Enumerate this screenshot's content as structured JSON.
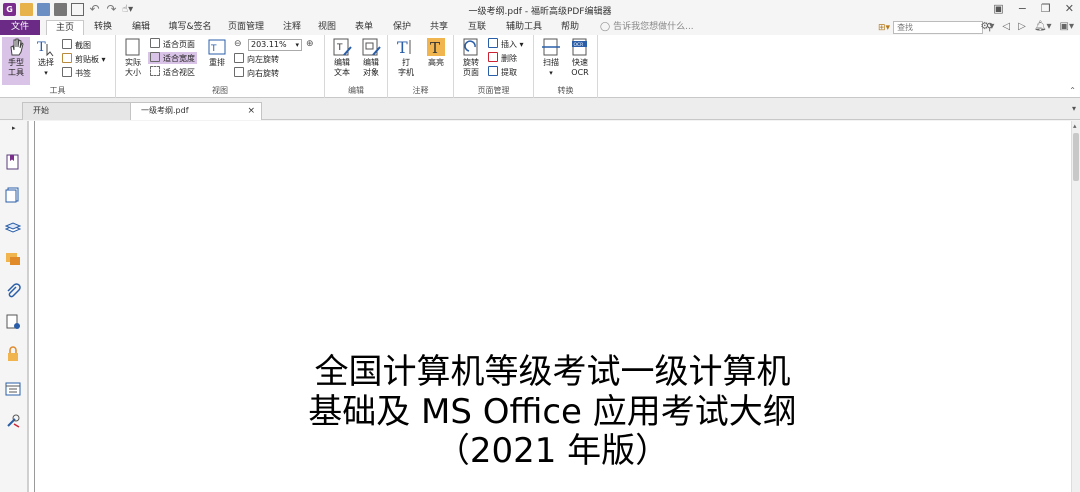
{
  "window": {
    "title": "一级考纲.pdf - 福昕高级PDF编辑器"
  },
  "quick_access": {
    "icons": [
      "app-logo-icon",
      "open-icon",
      "save-icon",
      "print-icon",
      "email-icon",
      "new-icon",
      "undo-icon",
      "redo-icon",
      "hand-icon"
    ]
  },
  "menu": {
    "file": "文件",
    "tabs": [
      "主页",
      "转换",
      "编辑",
      "填写&签名",
      "页面管理",
      "注释",
      "视图",
      "表单",
      "保护",
      "共享",
      "互联",
      "辅助工具",
      "帮助"
    ],
    "active": "主页",
    "tell_me": "告诉我您想做什么...",
    "search_placeholder": "查找"
  },
  "ribbon": {
    "tools": {
      "label": "工具",
      "hand": "手型\n工具",
      "select": "选择",
      "screenshot": "截图",
      "clipboard": "剪贴板",
      "bookmark": "书签"
    },
    "view": {
      "label": "视图",
      "actual": "实际\n大小",
      "fit_page": "适合页面",
      "fit_width": "适合宽度",
      "fit_visible": "适合视区",
      "reflow": "重排",
      "zoom": "203.11%",
      "rotate_left": "向左旋转",
      "rotate_right": "向右旋转"
    },
    "edit": {
      "label": "编辑",
      "edit_text": "编辑\n文本",
      "edit_object": "编辑\n对象"
    },
    "comment": {
      "label": "注释",
      "typewriter": "打\n字机",
      "highlight": "高亮"
    },
    "pages": {
      "label": "页面管理",
      "rotate": "旋转\n页面",
      "insert": "插入",
      "delete": "删除",
      "extract": "提取"
    },
    "convert": {
      "label": "转换",
      "scan": "扫描",
      "ocr": "快速\nOCR"
    }
  },
  "doc_tabs": {
    "home": "开始",
    "doc": "一级考纲.pdf",
    "close": "×"
  },
  "document": {
    "title_lines": [
      "全国计算机等级考试一级计算机",
      "基础及 MS Office 应用考试大纲",
      "（2021 年版）"
    ]
  },
  "colors": {
    "accent": "#6a2a86",
    "selected": "#d9c3e6"
  }
}
